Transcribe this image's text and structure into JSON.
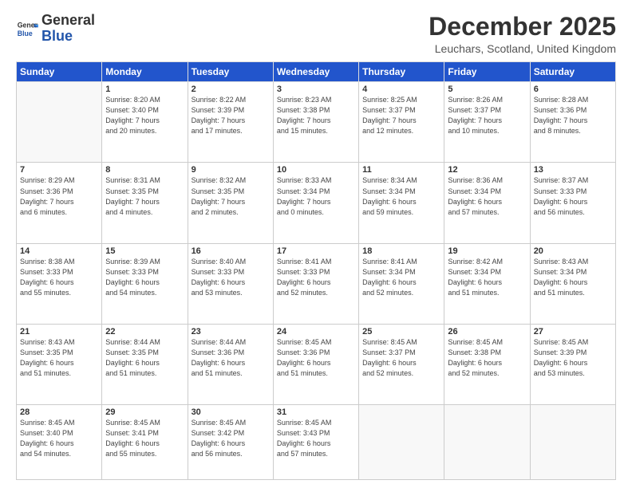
{
  "header": {
    "logo_general": "General",
    "logo_blue": "Blue",
    "month_title": "December 2025",
    "location": "Leuchars, Scotland, United Kingdom"
  },
  "weekdays": [
    "Sunday",
    "Monday",
    "Tuesday",
    "Wednesday",
    "Thursday",
    "Friday",
    "Saturday"
  ],
  "weeks": [
    [
      {
        "day": "",
        "info": ""
      },
      {
        "day": "1",
        "info": "Sunrise: 8:20 AM\nSunset: 3:40 PM\nDaylight: 7 hours\nand 20 minutes."
      },
      {
        "day": "2",
        "info": "Sunrise: 8:22 AM\nSunset: 3:39 PM\nDaylight: 7 hours\nand 17 minutes."
      },
      {
        "day": "3",
        "info": "Sunrise: 8:23 AM\nSunset: 3:38 PM\nDaylight: 7 hours\nand 15 minutes."
      },
      {
        "day": "4",
        "info": "Sunrise: 8:25 AM\nSunset: 3:37 PM\nDaylight: 7 hours\nand 12 minutes."
      },
      {
        "day": "5",
        "info": "Sunrise: 8:26 AM\nSunset: 3:37 PM\nDaylight: 7 hours\nand 10 minutes."
      },
      {
        "day": "6",
        "info": "Sunrise: 8:28 AM\nSunset: 3:36 PM\nDaylight: 7 hours\nand 8 minutes."
      }
    ],
    [
      {
        "day": "7",
        "info": "Sunrise: 8:29 AM\nSunset: 3:36 PM\nDaylight: 7 hours\nand 6 minutes."
      },
      {
        "day": "8",
        "info": "Sunrise: 8:31 AM\nSunset: 3:35 PM\nDaylight: 7 hours\nand 4 minutes."
      },
      {
        "day": "9",
        "info": "Sunrise: 8:32 AM\nSunset: 3:35 PM\nDaylight: 7 hours\nand 2 minutes."
      },
      {
        "day": "10",
        "info": "Sunrise: 8:33 AM\nSunset: 3:34 PM\nDaylight: 7 hours\nand 0 minutes."
      },
      {
        "day": "11",
        "info": "Sunrise: 8:34 AM\nSunset: 3:34 PM\nDaylight: 6 hours\nand 59 minutes."
      },
      {
        "day": "12",
        "info": "Sunrise: 8:36 AM\nSunset: 3:34 PM\nDaylight: 6 hours\nand 57 minutes."
      },
      {
        "day": "13",
        "info": "Sunrise: 8:37 AM\nSunset: 3:33 PM\nDaylight: 6 hours\nand 56 minutes."
      }
    ],
    [
      {
        "day": "14",
        "info": "Sunrise: 8:38 AM\nSunset: 3:33 PM\nDaylight: 6 hours\nand 55 minutes."
      },
      {
        "day": "15",
        "info": "Sunrise: 8:39 AM\nSunset: 3:33 PM\nDaylight: 6 hours\nand 54 minutes."
      },
      {
        "day": "16",
        "info": "Sunrise: 8:40 AM\nSunset: 3:33 PM\nDaylight: 6 hours\nand 53 minutes."
      },
      {
        "day": "17",
        "info": "Sunrise: 8:41 AM\nSunset: 3:33 PM\nDaylight: 6 hours\nand 52 minutes."
      },
      {
        "day": "18",
        "info": "Sunrise: 8:41 AM\nSunset: 3:34 PM\nDaylight: 6 hours\nand 52 minutes."
      },
      {
        "day": "19",
        "info": "Sunrise: 8:42 AM\nSunset: 3:34 PM\nDaylight: 6 hours\nand 51 minutes."
      },
      {
        "day": "20",
        "info": "Sunrise: 8:43 AM\nSunset: 3:34 PM\nDaylight: 6 hours\nand 51 minutes."
      }
    ],
    [
      {
        "day": "21",
        "info": "Sunrise: 8:43 AM\nSunset: 3:35 PM\nDaylight: 6 hours\nand 51 minutes."
      },
      {
        "day": "22",
        "info": "Sunrise: 8:44 AM\nSunset: 3:35 PM\nDaylight: 6 hours\nand 51 minutes."
      },
      {
        "day": "23",
        "info": "Sunrise: 8:44 AM\nSunset: 3:36 PM\nDaylight: 6 hours\nand 51 minutes."
      },
      {
        "day": "24",
        "info": "Sunrise: 8:45 AM\nSunset: 3:36 PM\nDaylight: 6 hours\nand 51 minutes."
      },
      {
        "day": "25",
        "info": "Sunrise: 8:45 AM\nSunset: 3:37 PM\nDaylight: 6 hours\nand 52 minutes."
      },
      {
        "day": "26",
        "info": "Sunrise: 8:45 AM\nSunset: 3:38 PM\nDaylight: 6 hours\nand 52 minutes."
      },
      {
        "day": "27",
        "info": "Sunrise: 8:45 AM\nSunset: 3:39 PM\nDaylight: 6 hours\nand 53 minutes."
      }
    ],
    [
      {
        "day": "28",
        "info": "Sunrise: 8:45 AM\nSunset: 3:40 PM\nDaylight: 6 hours\nand 54 minutes."
      },
      {
        "day": "29",
        "info": "Sunrise: 8:45 AM\nSunset: 3:41 PM\nDaylight: 6 hours\nand 55 minutes."
      },
      {
        "day": "30",
        "info": "Sunrise: 8:45 AM\nSunset: 3:42 PM\nDaylight: 6 hours\nand 56 minutes."
      },
      {
        "day": "31",
        "info": "Sunrise: 8:45 AM\nSunset: 3:43 PM\nDaylight: 6 hours\nand 57 minutes."
      },
      {
        "day": "",
        "info": ""
      },
      {
        "day": "",
        "info": ""
      },
      {
        "day": "",
        "info": ""
      }
    ]
  ]
}
